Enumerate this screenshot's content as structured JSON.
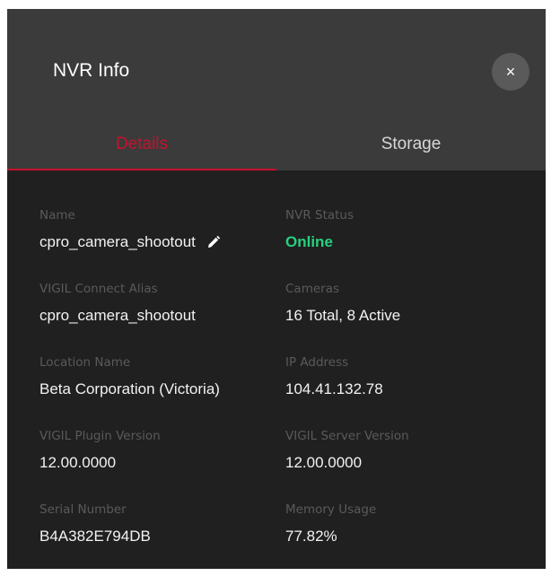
{
  "dialog": {
    "title": "NVR Info",
    "close_icon": "×"
  },
  "tabs": [
    {
      "label": "Details",
      "active": true
    },
    {
      "label": "Storage",
      "active": false
    }
  ],
  "fields": {
    "name": {
      "label": "Name",
      "value": "cpro_camera_shootout"
    },
    "nvr_status": {
      "label": "NVR Status",
      "value": "Online"
    },
    "connect_alias": {
      "label": "VIGIL Connect Alias",
      "value": "cpro_camera_shootout"
    },
    "cameras": {
      "label": "Cameras",
      "value": "16 Total, 8 Active"
    },
    "location_name": {
      "label": "Location Name",
      "value": "Beta Corporation (Victoria)"
    },
    "ip_address": {
      "label": "IP Address",
      "value": "104.41.132.78"
    },
    "plugin_version": {
      "label": "VIGIL Plugin Version",
      "value": "12.00.0000"
    },
    "server_version": {
      "label": "VIGIL Server Version",
      "value": "12.00.0000"
    },
    "serial_number": {
      "label": "Serial Number",
      "value": "B4A382E794DB"
    },
    "memory_usage": {
      "label": "Memory Usage",
      "value": "77.82%"
    }
  },
  "colors": {
    "accent": "#c8102e",
    "online": "#27d17f",
    "header_bg": "#3b3b3b",
    "body_bg": "#202020"
  },
  "icons": {
    "edit": "pencil-icon",
    "close": "close-icon"
  }
}
